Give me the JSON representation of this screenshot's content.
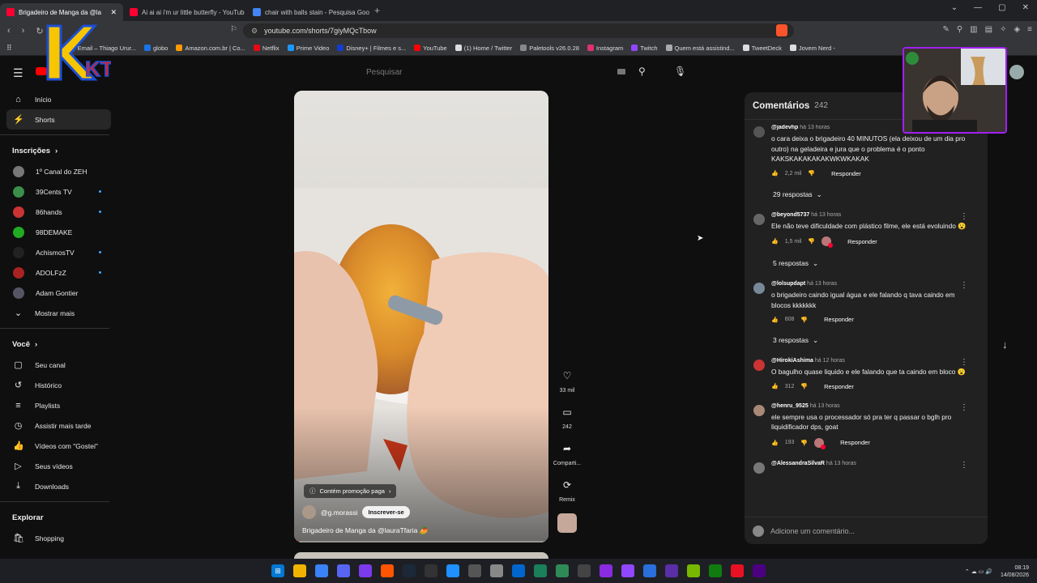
{
  "browser": {
    "tabs": [
      {
        "label": "Brigadeiro de Manga da @la",
        "active": true,
        "color": "#ff0033"
      },
      {
        "label": "Ai ai ai i'm ur little butterfly - YouTub",
        "active": false,
        "color": "#ff0033"
      },
      {
        "label": "chair with balls stain - Pesquisa Goog",
        "active": false,
        "color": "#4285f4"
      }
    ],
    "url": "youtube.com/shorts/7giyMQcTbow",
    "bookmarks": [
      {
        "label": "Email – Thiago Urur...",
        "color": "#4a8bd6"
      },
      {
        "label": "globo",
        "color": "#1a73e8"
      },
      {
        "label": "Amazon.com.br | Co...",
        "color": "#ff9900"
      },
      {
        "label": "Netflix",
        "color": "#e50914"
      },
      {
        "label": "Prime Video",
        "color": "#1a98ff"
      },
      {
        "label": "Disney+ | Filmes e s...",
        "color": "#113ccf"
      },
      {
        "label": "YouTube",
        "color": "#ff0000"
      },
      {
        "label": "(1) Home / Twitter",
        "color": "#dddddd"
      },
      {
        "label": "Paletools v26.0.28",
        "color": "#888888"
      },
      {
        "label": "Instagram",
        "color": "#e1306c"
      },
      {
        "label": "Twitch",
        "color": "#9146ff"
      },
      {
        "label": "Quem está assistind...",
        "color": "#aaaaaa"
      },
      {
        "label": "TweetDeck",
        "color": "#dddddd"
      },
      {
        "label": "Jovem Nerd -",
        "color": "#dddddd"
      }
    ]
  },
  "overlay": {
    "logo": "KTV"
  },
  "youtube": {
    "search_placeholder": "Pesquisar",
    "sidebar": {
      "main": [
        {
          "label": "Início",
          "icon": "home-icon",
          "glyph": "⌂",
          "active": false
        },
        {
          "label": "Shorts",
          "icon": "shorts-icon",
          "glyph": "⚡",
          "active": true
        }
      ],
      "subscriptions_title": "Inscrições",
      "subscriptions": [
        {
          "label": "1º Canal do ZEH",
          "color": "#777",
          "dot": false
        },
        {
          "label": "39Cents TV",
          "color": "#3a8f4a",
          "dot": true
        },
        {
          "label": "86hands",
          "color": "#c33",
          "dot": true
        },
        {
          "label": "98DEMAKE",
          "color": "#2a2",
          "dot": false
        },
        {
          "label": "AchismosTV",
          "color": "#222",
          "dot": true
        },
        {
          "label": "ADOLFzZ",
          "color": "#a22",
          "dot": true
        },
        {
          "label": "Adam Gontier",
          "color": "#556",
          "dot": false
        }
      ],
      "show_more": "Mostrar mais",
      "you_title": "Você",
      "you": [
        {
          "label": "Seu canal",
          "glyph": "▢",
          "icon": "your-channel-icon"
        },
        {
          "label": "Histórico",
          "glyph": "↺",
          "icon": "history-icon"
        },
        {
          "label": "Playlists",
          "glyph": "≡",
          "icon": "playlists-icon"
        },
        {
          "label": "Assistir mais tarde",
          "glyph": "◷",
          "icon": "watch-later-icon"
        },
        {
          "label": "Vídeos com \"Gostei\"",
          "glyph": "👍",
          "icon": "liked-videos-icon"
        },
        {
          "label": "Seus vídeos",
          "glyph": "▷",
          "icon": "your-videos-icon"
        },
        {
          "label": "Downloads",
          "glyph": "⤓",
          "icon": "downloads-icon"
        }
      ],
      "explore_title": "Explorar",
      "explore": [
        {
          "label": "Shopping",
          "glyph": "🛍",
          "icon": "shopping-icon"
        }
      ]
    },
    "short": {
      "promo": "Contém promoção paga",
      "channel": "@g.morassi",
      "subscribe": "Inscrever-se",
      "title": "Brigadeiro de Manga da @lauraTfaria 🥭",
      "progress": 0.02,
      "actions": [
        {
          "label": "33 mil",
          "glyph": "♡",
          "icon": "like-icon"
        },
        {
          "label": "242",
          "glyph": "▭",
          "icon": "comment-icon"
        },
        {
          "label": "Comparti...",
          "glyph": "➦",
          "icon": "share-icon"
        },
        {
          "label": "Remix",
          "glyph": "⟳",
          "icon": "remix-icon"
        }
      ]
    },
    "comments": {
      "title": "Comentários",
      "count": "242",
      "items": [
        {
          "author": "@jadevhp",
          "time": "há 13 horas",
          "text": "o cara deixa o brigadeiro 40 MINUTOS (ela deixou de um dia pro outro) na geladeira e jura que o problema é o ponto KAKSKAKAKAKAKWKWKAKAK",
          "likes": "2,2 mil",
          "replies": "29 respostas",
          "color": "#555",
          "hearted": false,
          "menu": false
        },
        {
          "author": "@beyond5737",
          "time": "há 13 horas",
          "text": "Ele não teve dificuldade com plástico filme, ele está evoluindo 😮",
          "likes": "1,5 mil",
          "replies": "5 respostas",
          "color": "#666",
          "hearted": true,
          "menu": true
        },
        {
          "author": "@lolsupdapt",
          "time": "há 13 horas",
          "text": "o brigadeiro caindo igual água e ele falando q tava caindo em blocos kkkkkkk",
          "likes": "608",
          "replies": "3 respostas",
          "color": "#789",
          "hearted": false,
          "menu": true
        },
        {
          "author": "@HirokiAshima",
          "time": "há 12 horas",
          "text": "O bagulho quase liquido e ele falando que ta caindo em bloco 😮",
          "likes": "312",
          "replies": "",
          "color": "#c33",
          "hearted": false,
          "menu": true
        },
        {
          "author": "@henru_9525",
          "time": "há 13 horas",
          "text": "ele sempre usa o processador só pra ter q passar o bglh pro liquidificador dps, goat",
          "likes": "193",
          "replies": "",
          "color": "#a87",
          "hearted": true,
          "menu": true
        },
        {
          "author": "@AlessandraSilvaR",
          "time": "há 13 horas",
          "text": "",
          "likes": "",
          "replies": "",
          "color": "#777",
          "hearted": false,
          "menu": true
        }
      ],
      "reply_label": "Responder",
      "input_placeholder": "Adicione um comentário..."
    }
  },
  "taskbar": {
    "apps": [
      "#0078d4",
      "#f0b400",
      "#3b82f6",
      "#5865f2",
      "#7c3aed",
      "#ff5500",
      "#1b2838",
      "#333333",
      "#1e90ff",
      "#555555",
      "#888888",
      "#0066cc",
      "#1a7f5a",
      "#2e8b57",
      "#444444",
      "#8a2be2",
      "#9146ff",
      "#2a6fdb",
      "#5a2ea6",
      "#76b900",
      "#107c10",
      "#e81123",
      "#4b0082"
    ],
    "lang_icons": "⌃ ☁ ▭ 🔊",
    "time": "08:19",
    "date": "14/08/2026"
  }
}
